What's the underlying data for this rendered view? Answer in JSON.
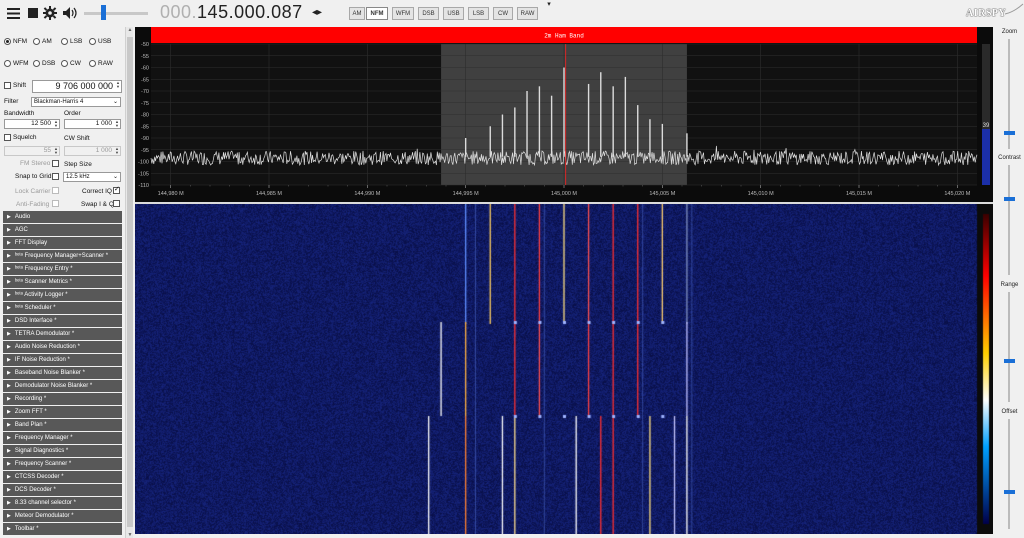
{
  "toolbar": {
    "frequency_prefix": "000.",
    "frequency_main": "145.000.087",
    "frequency_arrows": "◂▸",
    "modes": [
      "AM",
      "NFM",
      "WFM",
      "DSB",
      "USB",
      "LSB",
      "CW",
      "RAW"
    ],
    "active_mode": "NFM",
    "volume_level": 0.28,
    "logo_text": "AIRSPY"
  },
  "radio": {
    "modes": [
      {
        "label": "NFM",
        "checked": true
      },
      {
        "label": "AM",
        "checked": false
      },
      {
        "label": "LSB",
        "checked": false
      },
      {
        "label": "USB",
        "checked": false
      },
      {
        "label": "WFM",
        "checked": false
      },
      {
        "label": "DSB",
        "checked": false
      },
      {
        "label": "CW",
        "checked": false
      },
      {
        "label": "RAW",
        "checked": false
      }
    ],
    "shift_label": "Shift",
    "shift_value": "9 706 000 000",
    "filter_label": "Filter",
    "filter_value": "Blackman-Harris 4",
    "bandwidth_label": "Bandwidth",
    "bandwidth_value": "12 500",
    "order_label": "Order",
    "order_value": "1 000",
    "squelch_label": "Squelch",
    "cw_shift_label": "CW Shift",
    "squelch_value": "55",
    "cw_shift_value": "1 000",
    "fm_stereo_label": "FM Stereo",
    "step_size_label": "Step Size",
    "snap_label": "Snap to Grid",
    "step_size_value": "12.5 kHz",
    "lock_carrier_label": "Lock Carrier",
    "correct_iq_label": "Correct IQ",
    "anti_fading_label": "Anti-Fading",
    "swap_iq_label": "Swap I & Q"
  },
  "sections": [
    "Audio",
    "AGC",
    "FFT Display",
    "ᵇᵉᵗᵃ Frequency Manager+Scanner *",
    "ᵇᵉᵗᵃ Frequency Entry *",
    "ᵇᵉᵗᵃ Scanner Metrics *",
    "ᵇᵉᵗᵃ Activity Logger *",
    "ᵇᵉᵗᵃ Scheduler *",
    "DSD Interface *",
    "TETRA Demodulator *",
    "Audio Noise Reduction *",
    "IF Noise Reduction *",
    "Baseband Noise Blanker *",
    "Demodulator Noise Blanker *",
    "Recording *",
    "Zoom FFT *",
    "Band Plan *",
    "Frequency Manager *",
    "Signal Diagnostics *",
    "Frequency Scanner *",
    "CTCSS Decoder *",
    "DCS Decoder *",
    "8.33 channel selector *",
    "Meteor Demodulator *",
    "Toolbar *"
  ],
  "spectrum": {
    "band_label": "2m Ham Band",
    "band_color": "#ff0000",
    "y_ticks": [
      "-50",
      "-55",
      "-60",
      "-65",
      "-70",
      "-75",
      "-80",
      "-85",
      "-90",
      "-95",
      "-100",
      "-105",
      "-110"
    ],
    "x_ticks": [
      "144,980 M",
      "144,985 M",
      "144,990 M",
      "144,995 M",
      "145,000 M",
      "145,005 M",
      "145,010 M",
      "145,015 M",
      "145,020 M"
    ],
    "level_readout": "39",
    "trace_color": "#e0e0e0",
    "filter_overlay_color": "#5a5a5a",
    "cursor_color": "#ff2020"
  },
  "right_panel": {
    "zoom_label": "Zoom",
    "contrast_label": "Contrast",
    "range_label": "Range",
    "offset_label": "Offset"
  }
}
